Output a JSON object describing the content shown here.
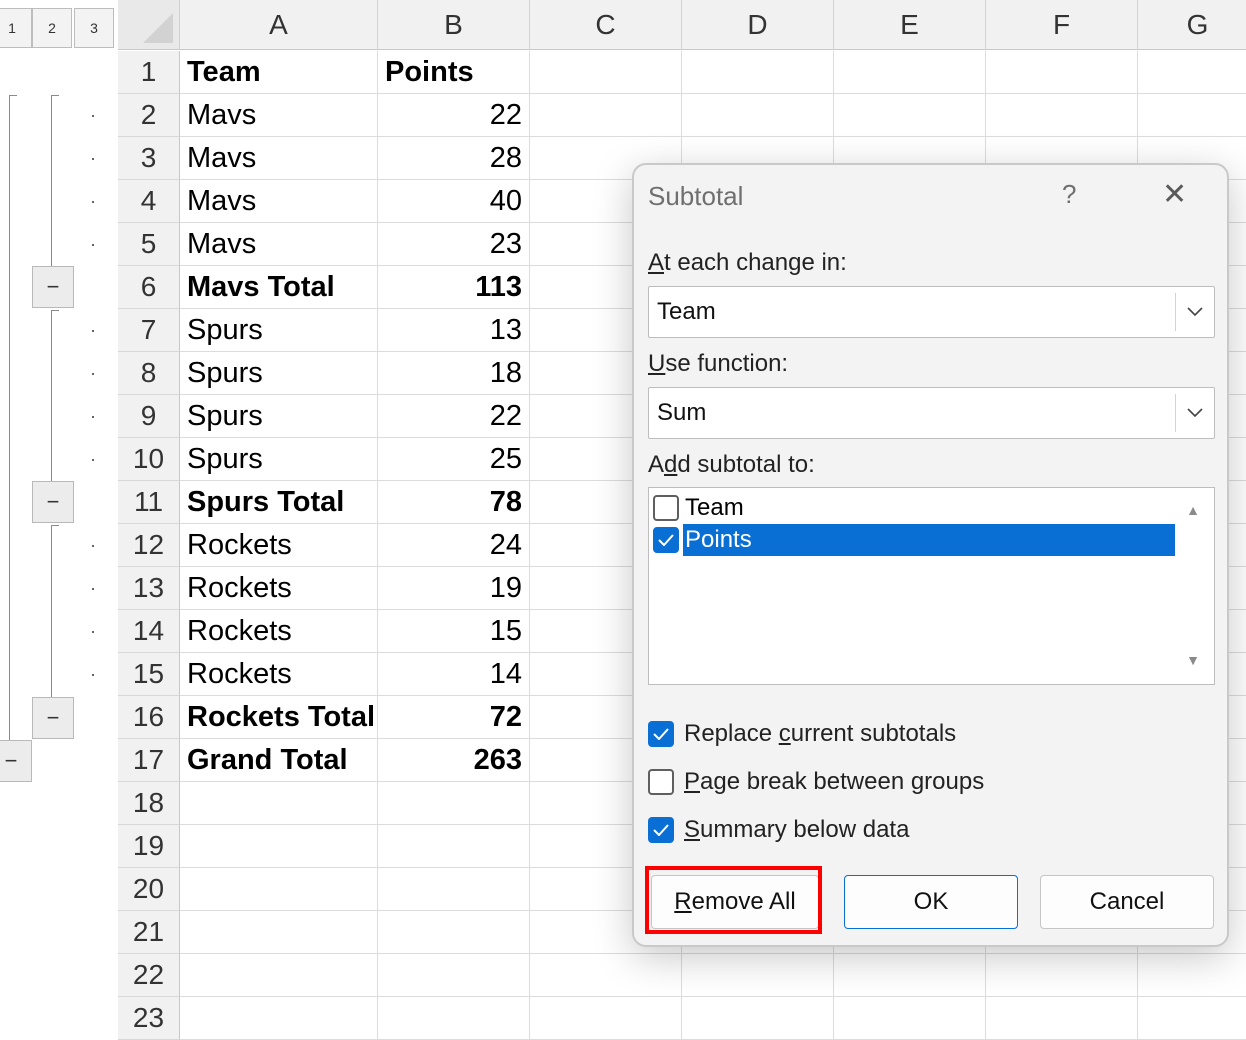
{
  "outline": {
    "levels": [
      "1",
      "2",
      "3"
    ],
    "collapse_symbol": "−"
  },
  "sheet": {
    "columns": [
      "A",
      "B",
      "C",
      "D",
      "E",
      "F",
      "G"
    ],
    "rows": [
      {
        "n": "1",
        "a": "Team",
        "b": "Points",
        "bold": true,
        "header": true
      },
      {
        "n": "2",
        "a": "Mavs",
        "b": "22",
        "bold": false
      },
      {
        "n": "3",
        "a": "Mavs",
        "b": "28",
        "bold": false
      },
      {
        "n": "4",
        "a": "Mavs",
        "b": "40",
        "bold": false
      },
      {
        "n": "5",
        "a": "Mavs",
        "b": "23",
        "bold": false
      },
      {
        "n": "6",
        "a": "Mavs Total",
        "b": "113",
        "bold": true
      },
      {
        "n": "7",
        "a": "Spurs",
        "b": "13",
        "bold": false
      },
      {
        "n": "8",
        "a": "Spurs",
        "b": "18",
        "bold": false
      },
      {
        "n": "9",
        "a": "Spurs",
        "b": "22",
        "bold": false
      },
      {
        "n": "10",
        "a": "Spurs",
        "b": "25",
        "bold": false
      },
      {
        "n": "11",
        "a": "Spurs Total",
        "b": "78",
        "bold": true
      },
      {
        "n": "12",
        "a": "Rockets",
        "b": "24",
        "bold": false
      },
      {
        "n": "13",
        "a": "Rockets",
        "b": "19",
        "bold": false
      },
      {
        "n": "14",
        "a": "Rockets",
        "b": "15",
        "bold": false
      },
      {
        "n": "15",
        "a": "Rockets",
        "b": "14",
        "bold": false
      },
      {
        "n": "16",
        "a": "Rockets Total",
        "b": "72",
        "bold": true
      },
      {
        "n": "17",
        "a": "Grand Total",
        "b": "263",
        "bold": true
      },
      {
        "n": "18",
        "a": "",
        "b": "",
        "bold": false
      },
      {
        "n": "19",
        "a": "",
        "b": "",
        "bold": false
      },
      {
        "n": "20",
        "a": "",
        "b": "",
        "bold": false
      },
      {
        "n": "21",
        "a": "",
        "b": "",
        "bold": false
      },
      {
        "n": "22",
        "a": "",
        "b": "",
        "bold": false
      },
      {
        "n": "23",
        "a": "",
        "b": "",
        "bold": false
      }
    ]
  },
  "dialog": {
    "title": "Subtotal",
    "help": "?",
    "close": "✕",
    "change_label_u": "A",
    "change_label_rest": "t each change in:",
    "change_value": "Team",
    "function_label_u": "U",
    "function_label_rest": "se function:",
    "function_value": "Sum",
    "add_label_pre": "A",
    "add_label_u": "d",
    "add_label_rest": "d subtotal to:",
    "add_items": [
      {
        "label": "Team",
        "checked": false,
        "selected": false
      },
      {
        "label": "Points",
        "checked": true,
        "selected": true
      }
    ],
    "options": {
      "replace": {
        "pre": "Replace ",
        "u": "c",
        "rest": "urrent subtotals",
        "checked": true
      },
      "page_break": {
        "pre": "",
        "u": "P",
        "rest": "age break between groups",
        "checked": false
      },
      "summary_below": {
        "pre": "",
        "u": "S",
        "rest": "ummary below data",
        "checked": true
      }
    },
    "buttons": {
      "remove_all_u": "R",
      "remove_all_rest": "emove All",
      "ok": "OK",
      "cancel": "Cancel"
    }
  },
  "colors": {
    "selection_blue": "#0a6fd4",
    "highlight_red": "#ff0000"
  },
  "icons": {
    "chevron": "chevron-down-icon",
    "check": "checkmark-icon",
    "scroll_up": "scroll-up-arrow-icon",
    "scroll_down": "scroll-down-arrow-icon"
  }
}
